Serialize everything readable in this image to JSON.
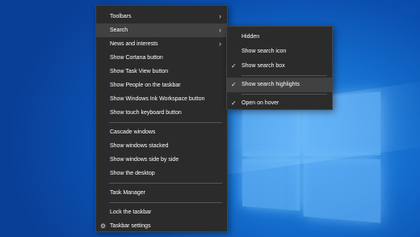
{
  "context_menu": {
    "items": [
      {
        "label": "Toolbars",
        "submenu": true
      },
      {
        "label": "Search",
        "submenu": true,
        "active": true
      },
      {
        "label": "News and interests",
        "submenu": true
      },
      {
        "label": "Show Cortana button"
      },
      {
        "label": "Show Task View button"
      },
      {
        "label": "Show People on the taskbar"
      },
      {
        "label": "Show Windows Ink Workspace button"
      },
      {
        "label": "Show touch keyboard button"
      },
      {
        "label": "Cascade windows"
      },
      {
        "label": "Show windows stacked"
      },
      {
        "label": "Show windows side by side"
      },
      {
        "label": "Show the desktop"
      },
      {
        "label": "Task Manager"
      },
      {
        "label": "Lock the taskbar"
      },
      {
        "label": "Taskbar settings",
        "icon": "gear-icon"
      }
    ]
  },
  "search_submenu": {
    "items": [
      {
        "label": "Hidden",
        "checked": false
      },
      {
        "label": "Show search icon",
        "checked": false
      },
      {
        "label": "Show search box",
        "checked": true
      },
      {
        "label": "Show search highlights",
        "checked": true,
        "active": true
      },
      {
        "label": "Open on hover",
        "checked": true
      }
    ]
  },
  "icons": {
    "submenu_arrow": "chevron-right-icon",
    "check": "checkmark-icon",
    "settings": "gear-icon"
  }
}
